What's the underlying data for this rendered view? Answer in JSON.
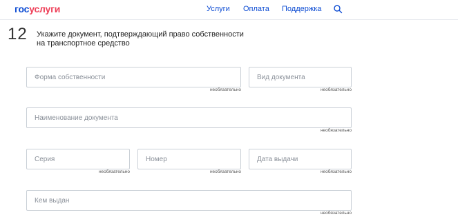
{
  "header": {
    "logo": {
      "part1": "гос",
      "part2": "услуги"
    },
    "nav": [
      {
        "label": "Услуги"
      },
      {
        "label": "Оплата"
      },
      {
        "label": "Поддержка"
      }
    ],
    "search_icon": "search-icon"
  },
  "step": {
    "number": "12",
    "title_line1": "Укажите документ, подтверждающий право собственности",
    "title_line2": "на транспортное средство"
  },
  "form": {
    "optional_label": "необязательно",
    "fields": {
      "ownership_form": {
        "placeholder": "Форма собственности"
      },
      "document_type": {
        "placeholder": "Вид документа"
      },
      "document_name": {
        "placeholder": "Наименование документа"
      },
      "series": {
        "placeholder": "Серия"
      },
      "number": {
        "placeholder": "Номер"
      },
      "issue_date": {
        "placeholder": "Дата выдачи"
      },
      "issued_by": {
        "placeholder": "Кем выдан"
      }
    }
  },
  "colors": {
    "brand_blue": "#0d4cd3",
    "brand_red": "#ee3f58",
    "border": "#c9cfd6"
  }
}
